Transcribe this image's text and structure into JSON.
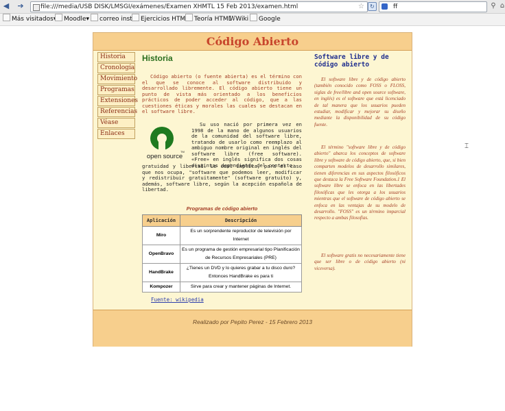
{
  "browser": {
    "url": "file:///media/USB DISK/LMSGI/exámenes/Examen XHMTL 15 Feb 2013/examen.html",
    "search_value": "ff",
    "bookmarks": [
      "Más visitados",
      "Moodle",
      "correo insti",
      "Ejercicios HTML",
      "Teoría HTML",
      "Wiki",
      "Google"
    ]
  },
  "page": {
    "title": "Código Abierto",
    "nav": [
      "Historia",
      "Cronología",
      "Movimiento",
      "Programas",
      "Extensiones",
      "Referencias",
      "Véase",
      "Enlaces"
    ],
    "main": {
      "heading": "Historia",
      "p1": "Código abierto (o fuente abierta) es el término con el que se conoce al software distribuido y desarrollado libremente. El código abierto tiene un punto de vista más orientado a los beneficios prácticos de poder acceder al código, que a las cuestiones éticas y morales las cuales se destacan en el software libre.",
      "logo_text": "open source",
      "logo_tm": "TM",
      "p2a": "Su uso nació por primera vez en 1998 de la mano de algunos usuarios de la comunidad del software libre, tratando de usarlo como reemplazo al ambiguo nombre original en inglés del software libre (free software). «Free» en inglés significa dos cosas distintas dependiendo del contexto:",
      "p2b": "gratuidad y libertad. Lo cual implica, para el caso que nos ocupa, \"software que podemos leer, modificar y redistribuir gratuitamente\" (software gratuito) y, además, software libre, según la acepción española de libertad.",
      "table_caption": "Programas de código abierto",
      "table_headers": [
        "Aplicación",
        "Descripción"
      ],
      "table_rows": [
        {
          "app": "Miro",
          "desc": "Es un sorprendente reproductor de televisión por Internet"
        },
        {
          "app": "OpenBravo",
          "desc": "Es un programa de gestión empresarial tipo Planificación de Recursos Empresariales (PRE)"
        },
        {
          "app": "HandBrake",
          "desc": "¿Tienes un DVD y lo quieres grabar a tu disco duro? Entonces HandBrake es para ti"
        },
        {
          "app": "Kompozer",
          "desc": "Sirve para crear y mantener páginas de Internet."
        }
      ],
      "source_link": "Fuente: wikipedia"
    },
    "aside": {
      "heading": "Software libre y de código abierto",
      "p1": "El software libre y de código abierto (también conocido como FOSS o FLOSS, siglas de free/libre and open source software, en inglés) es el software que está licenciado de tal manera que los usuarios pueden estudiar, modificar y mejorar su diseño mediante la disponibilidad de su código fuente.",
      "p2": "El término \"software libre y de código abierto\" abarca los conceptos de software libre y software de código abierto, que, si bien comparten modelos de desarrollo similares, tienen diferencias en sus aspectos filosóficos que destaca la Free Software Foundation.1 El software libre se enfoca en las libertades filosóficas que les otorga a los usuarios mientras que el software de código abierto se enfoca en las ventajas de su modelo de desarrollo. \"FOSS\" es un término imparcial respecto a ambas filosofías.",
      "p3": "El software gratis no necesariamente tiene que ser libre o de código abierto (ni viceversa)."
    },
    "footer": "Realizado por Pepito Perez - 15 Febrero 2013"
  },
  "colors": {
    "header": "#f7cf8d",
    "page_bg": "#fdf6d2",
    "title": "#c8462c",
    "heading_green": "#2a6e1e"
  }
}
